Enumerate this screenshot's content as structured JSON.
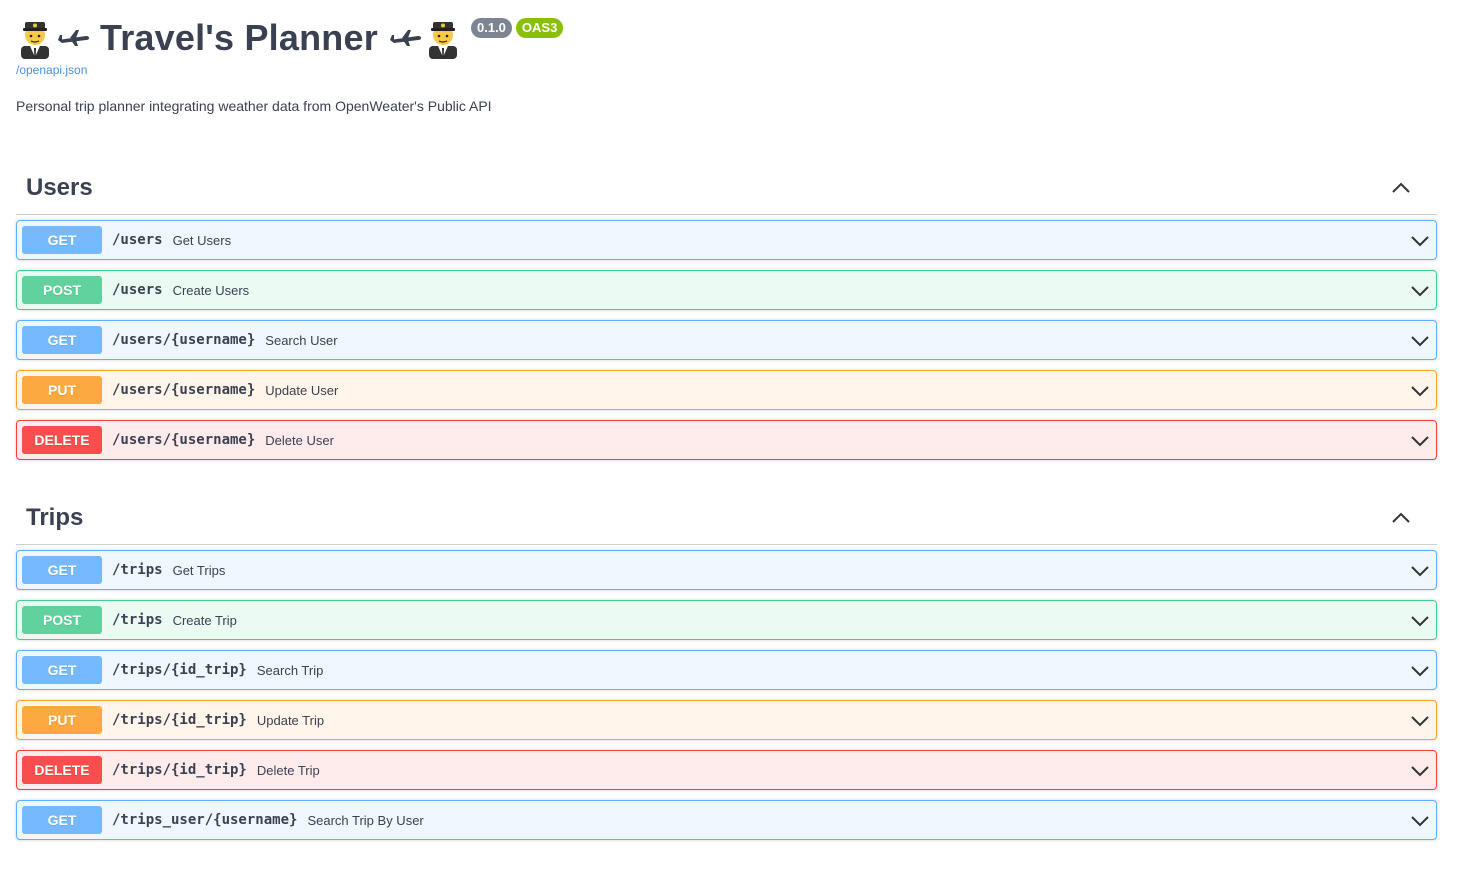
{
  "header": {
    "title": "Travel's Planner",
    "emoji_left": "pilot-emoji",
    "plane_left": "airplane-icon",
    "version": "0.1.0",
    "oas": "OAS3",
    "spec_link": "/openapi.json",
    "description": "Personal trip planner integrating weather data from OpenWeater's Public API"
  },
  "colors": {
    "get": "#61affe",
    "post": "#49cc90",
    "put": "#fca130",
    "delete": "#f93e3e",
    "text": "#3b4151",
    "link": "#4990e2"
  },
  "sections": [
    {
      "name": "Users",
      "operations": [
        {
          "method": "GET",
          "path": "/users",
          "summary": "Get Users"
        },
        {
          "method": "POST",
          "path": "/users",
          "summary": "Create Users"
        },
        {
          "method": "GET",
          "path": "/users/{username}",
          "summary": "Search User"
        },
        {
          "method": "PUT",
          "path": "/users/{username}",
          "summary": "Update User"
        },
        {
          "method": "DELETE",
          "path": "/users/{username}",
          "summary": "Delete User"
        }
      ]
    },
    {
      "name": "Trips",
      "operations": [
        {
          "method": "GET",
          "path": "/trips",
          "summary": "Get Trips"
        },
        {
          "method": "POST",
          "path": "/trips",
          "summary": "Create Trip"
        },
        {
          "method": "GET",
          "path": "/trips/{id_trip}",
          "summary": "Search Trip"
        },
        {
          "method": "PUT",
          "path": "/trips/{id_trip}",
          "summary": "Update Trip"
        },
        {
          "method": "DELETE",
          "path": "/trips/{id_trip}",
          "summary": "Delete Trip"
        },
        {
          "method": "GET",
          "path": "/trips_user/{username}",
          "summary": "Search Trip By User"
        }
      ]
    }
  ]
}
